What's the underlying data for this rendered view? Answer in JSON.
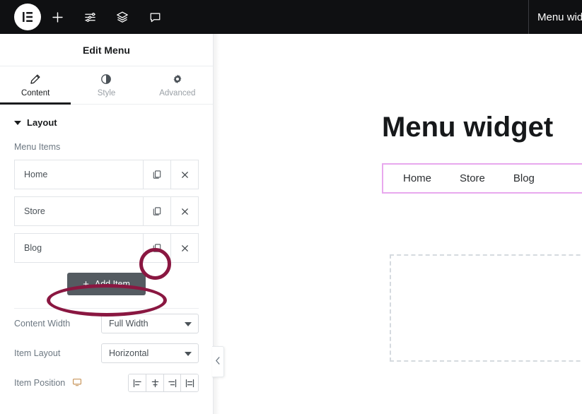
{
  "topbar": {
    "icons": [
      {
        "name": "elementor-logo-icon"
      },
      {
        "name": "add-element-icon"
      },
      {
        "name": "settings-sliders-icon"
      },
      {
        "name": "navigator-layers-icon"
      },
      {
        "name": "comments-icon"
      }
    ],
    "document_title": "Menu widget"
  },
  "panel": {
    "header_title": "Edit Menu",
    "tabs": [
      {
        "label": "Content",
        "icon": "pencil-icon",
        "active": true
      },
      {
        "label": "Style",
        "icon": "contrast-half-circle-icon",
        "active": false
      },
      {
        "label": "Advanced",
        "icon": "gear-icon",
        "active": false
      }
    ],
    "section": {
      "title": "Layout",
      "collapsed": false
    },
    "menu_items_label": "Menu Items",
    "menu_items": [
      {
        "title": "Home",
        "duplicate_icon": "duplicate-icon",
        "remove_icon": "close-x-icon"
      },
      {
        "title": "Store",
        "duplicate_icon": "duplicate-icon",
        "remove_icon": "close-x-icon"
      },
      {
        "title": "Blog",
        "duplicate_icon": "duplicate-icon",
        "remove_icon": "close-x-icon"
      }
    ],
    "add_item_label": "Add Item",
    "add_item_plus": "+",
    "controls": [
      {
        "label": "Content Width",
        "value": "Full Width"
      },
      {
        "label": "Item Layout",
        "value": "Horizontal"
      }
    ],
    "item_position": {
      "label": "Item Position",
      "device_icon": "desktop-icon",
      "choices": [
        {
          "name": "align-start-icon"
        },
        {
          "name": "align-center-icon"
        },
        {
          "name": "align-end-icon"
        },
        {
          "name": "align-stretch-icon"
        }
      ]
    }
  },
  "preview": {
    "heading": "Menu widget",
    "menu_links": [
      "Home",
      "Store",
      "Blog"
    ],
    "selection_border_color": "#e8a8ee",
    "placeholder": "empty-dropzone"
  },
  "annotations": {
    "color": "#8a1741",
    "shapes": [
      {
        "name": "highlight-duplicate-blog",
        "type": "circle"
      },
      {
        "name": "highlight-add-item",
        "type": "ellipse"
      }
    ]
  },
  "collapse_handle": {
    "icon": "chevron-left-icon"
  }
}
